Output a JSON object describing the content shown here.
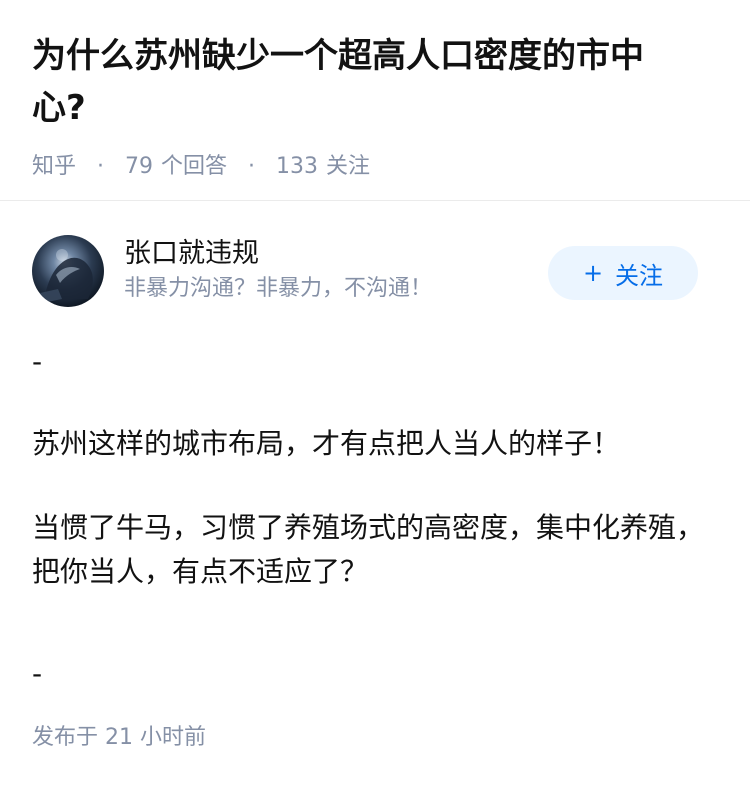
{
  "question": {
    "title": "为什么苏州缺少一个超高人口密度的市中心?",
    "source": "知乎",
    "answers_count": "79",
    "answers_label": "个回答",
    "followers_count": "133",
    "followers_label": "关注"
  },
  "author": {
    "name": "张口就违规",
    "bio": "非暴力沟通？非暴力，不沟通！",
    "follow_icon": "+",
    "follow_label": "关注"
  },
  "answer": {
    "dash_top": "-",
    "p1": "苏州这样的城市布局，才有点把人当人的样子！",
    "p2": "当惯了牛马，习惯了养殖场式的高密度，集中化养殖，把你当人，有点不适应了？",
    "dash_bottom": "-"
  },
  "footer": {
    "published_label": "发布于",
    "published_time": "21 小时前"
  },
  "colors": {
    "accent": "#056de8",
    "accent_bg": "#ebf5ff",
    "meta_text": "#8590a6",
    "body_text": "#121212"
  }
}
